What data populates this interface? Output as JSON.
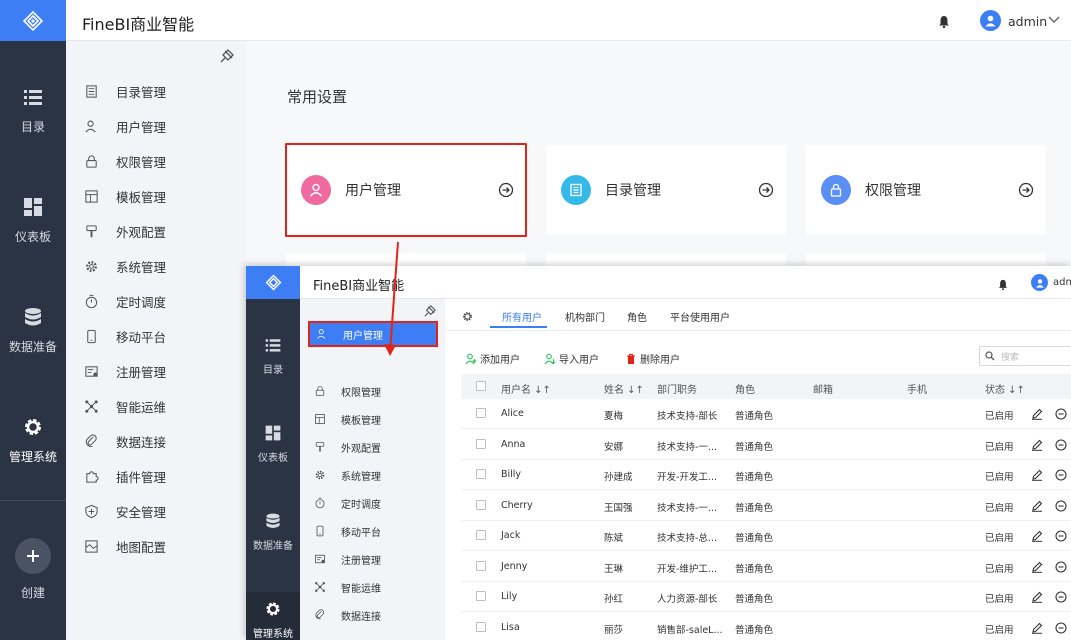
{
  "app": {
    "title": "FineBI商业智能",
    "user": "admin"
  },
  "rail": {
    "items": [
      {
        "label": "目录",
        "icon": "list-icon"
      },
      {
        "label": "仪表板",
        "icon": "dashboard-icon"
      },
      {
        "label": "数据准备",
        "icon": "database-icon"
      },
      {
        "label": "管理系统",
        "icon": "gear-icon"
      }
    ],
    "create_label": "创建"
  },
  "sidebar": {
    "items": [
      {
        "label": "目录管理",
        "icon": "catalog-icon"
      },
      {
        "label": "用户管理",
        "icon": "user-icon"
      },
      {
        "label": "权限管理",
        "icon": "lock-icon"
      },
      {
        "label": "模板管理",
        "icon": "template-icon"
      },
      {
        "label": "外观配置",
        "icon": "brush-icon"
      },
      {
        "label": "系统管理",
        "icon": "gear-icon"
      },
      {
        "label": "定时调度",
        "icon": "timer-icon"
      },
      {
        "label": "移动平台",
        "icon": "mobile-icon"
      },
      {
        "label": "注册管理",
        "icon": "register-icon"
      },
      {
        "label": "智能运维",
        "icon": "ops-icon"
      },
      {
        "label": "数据连接",
        "icon": "link-icon"
      },
      {
        "label": "插件管理",
        "icon": "plugin-icon"
      },
      {
        "label": "安全管理",
        "icon": "shield-icon"
      },
      {
        "label": "地图配置",
        "icon": "map-icon"
      }
    ]
  },
  "main": {
    "section_title": "常用设置",
    "cards": [
      {
        "label": "用户管理",
        "color": "#f06aa0"
      },
      {
        "label": "目录管理",
        "color": "#35b9e9"
      },
      {
        "label": "权限管理",
        "color": "#5b8ff5"
      }
    ]
  },
  "overlay": {
    "title": "FineBI商业智能",
    "user": "adm",
    "tabs": [
      "所有用户",
      "机构部门",
      "角色",
      "平台使用用户"
    ],
    "actions": {
      "add": "添加用户",
      "import": "导入用户",
      "delete": "删除用户"
    },
    "search_placeholder": "搜索",
    "columns": [
      "用户名",
      "姓名",
      "部门职务",
      "角色",
      "邮箱",
      "手机",
      "状态"
    ],
    "rows": [
      {
        "username": "Alice",
        "name": "夏梅",
        "dept": "技术支持-部长",
        "role": "普通角色",
        "status": "已启用"
      },
      {
        "username": "Anna",
        "name": "安娜",
        "dept": "技术支持-一...",
        "role": "普通角色",
        "status": "已启用"
      },
      {
        "username": "Billy",
        "name": "孙建成",
        "dept": "开发-开发工...",
        "role": "普通角色",
        "status": "已启用"
      },
      {
        "username": "Cherry",
        "name": "王国强",
        "dept": "技术支持-一...",
        "role": "普通角色",
        "status": "已启用"
      },
      {
        "username": "Jack",
        "name": "陈斌",
        "dept": "技术支持-总...",
        "role": "普通角色",
        "status": "已启用"
      },
      {
        "username": "Jenny",
        "name": "王琳",
        "dept": "开发-维护工...",
        "role": "普通角色",
        "status": "已启用"
      },
      {
        "username": "Lily",
        "name": "孙红",
        "dept": "人力资源-部长",
        "role": "普通角色",
        "status": "已启用"
      },
      {
        "username": "Lisa",
        "name": "丽莎",
        "dept": "销售部-saleL...",
        "role": "普通角色",
        "status": "已启用"
      }
    ]
  },
  "colors": {
    "accent": "#3d7ef5",
    "rail": "#2b3444",
    "highlight": "#e2231a"
  }
}
